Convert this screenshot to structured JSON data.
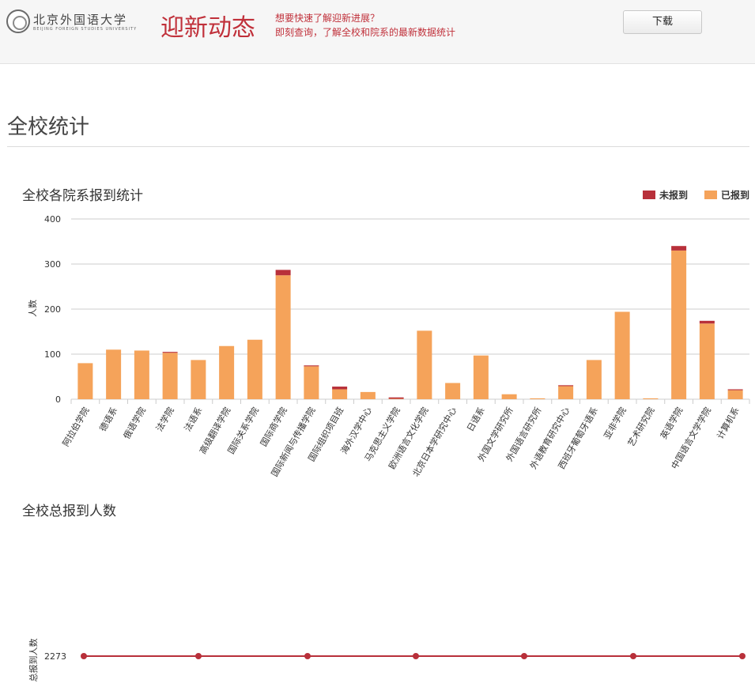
{
  "header": {
    "logo_name": "北京外国语大学",
    "logo_en": "BEIJING FOREIGN STUDIES UNIVERSITY",
    "title": "迎新动态",
    "subtitle_line1": "想要快速了解迎新进展？",
    "subtitle_line2": "即刻查询，了解全校和院系的最新数据统计",
    "download_label": "下载"
  },
  "colors": {
    "accent": "#c0303a",
    "registered": "#f5a35a",
    "unregistered": "#b8303a",
    "grid": "#cccccc"
  },
  "section": {
    "title": "全校统计"
  },
  "chart_data": [
    {
      "type": "bar",
      "stacked": true,
      "title": "全校各院系报到统计",
      "ylabel": "人数",
      "ylim": [
        0,
        400
      ],
      "yticks": [
        0,
        100,
        200,
        300,
        400
      ],
      "legend_position": "top-right",
      "categories": [
        "阿拉伯学院",
        "德语系",
        "俄语学院",
        "法学院",
        "法语系",
        "高级翻译学院",
        "国际关系学院",
        "国际商学院",
        "国际新闻与传播学院",
        "国际组织项目班",
        "海外汉学中心",
        "马克思主义学院",
        "欧洲语言文化学院",
        "北京日本学研究中心",
        "日语系",
        "外国文学研究所",
        "外国语言研究所",
        "外语教育研究中心",
        "西班牙葡萄牙语系",
        "亚非学院",
        "艺术研究院",
        "英语学院",
        "中国语言文学学院",
        "计算机系"
      ],
      "series": [
        {
          "name": "未报到",
          "values": [
            0,
            0,
            0,
            2,
            0,
            0,
            0,
            12,
            2,
            6,
            0,
            3,
            0,
            0,
            0,
            0,
            0,
            2,
            0,
            0,
            0,
            10,
            6,
            2
          ]
        },
        {
          "name": "已报到",
          "values": [
            80,
            110,
            108,
            103,
            87,
            118,
            132,
            275,
            73,
            22,
            16,
            1,
            152,
            36,
            97,
            11,
            2,
            29,
            87,
            194,
            2,
            330,
            168,
            20
          ]
        }
      ]
    },
    {
      "type": "line",
      "title": "全校总报到人数",
      "ylabel": "总报到人数",
      "yticks": [
        2273
      ],
      "values": [
        2273,
        2273,
        2273,
        2273,
        2273,
        2273,
        2273
      ]
    }
  ]
}
